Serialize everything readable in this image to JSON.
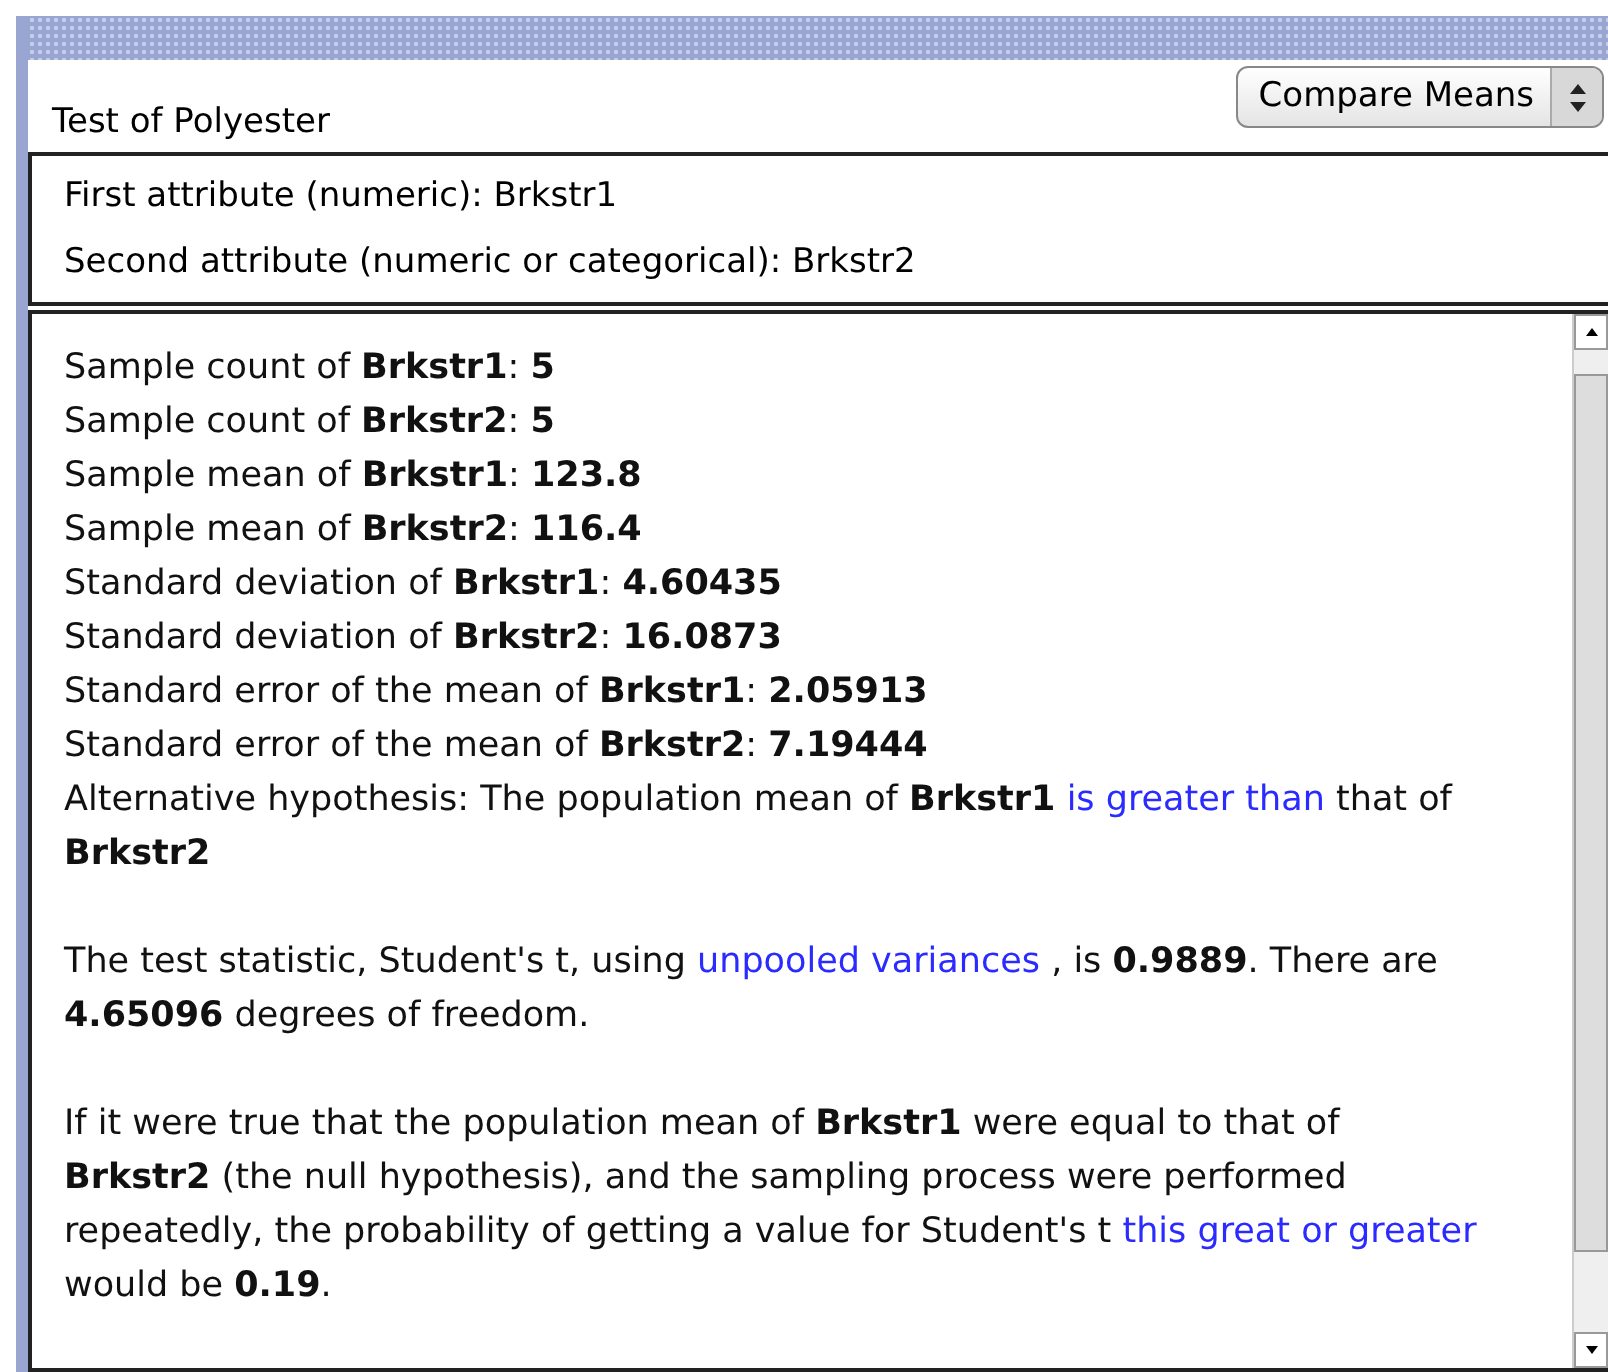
{
  "title": "Test of Polyester",
  "test_select": {
    "value": "Compare Means"
  },
  "attributes": [
    "First attribute (numeric): Brkstr1",
    "Second attribute (numeric or categorical): Brkstr2"
  ],
  "result_lines": [
    "Sample count of **Brkstr1**: **5**",
    "Sample count of **Brkstr2**: **5**",
    "Sample mean of **Brkstr1**: **123.8**",
    "Sample mean of **Brkstr2**: **116.4**",
    "Standard deviation of **Brkstr1**: **4.60435**",
    "Standard deviation of **Brkstr2**: **16.0873**",
    "Standard error of the mean of **Brkstr1**: **2.05913**",
    "Standard error of the mean of **Brkstr2**: **7.19444**"
  ],
  "result_paragraphs": [
    {
      "segments": [
        {
          "kind": "text",
          "text": "Alternative hypothesis: The population mean of **Brkstr1**"
        },
        {
          "kind": "link",
          "text": "is greater than"
        },
        {
          "kind": "text",
          "text": "that of **Brkstr2**"
        }
      ]
    },
    {
      "segments": [
        {
          "kind": "text",
          "text": "The test statistic, Student's t, using"
        },
        {
          "kind": "link",
          "text": "unpooled variances"
        },
        {
          "kind": "text",
          "text": ", is **0.9889**. There are **4.65096** degrees of freedom."
        }
      ]
    },
    {
      "segments": [
        {
          "kind": "text",
          "text": "If it were true that the population mean of **Brkstr1** were equal to that of **Brkstr2** (the null hypothesis), and the sampling process were performed repeatedly, the probability of getting a value for Student's t"
        },
        {
          "kind": "link",
          "text": "this great or greater"
        },
        {
          "kind": "text",
          "text": "would be **0.19**."
        }
      ]
    }
  ]
}
